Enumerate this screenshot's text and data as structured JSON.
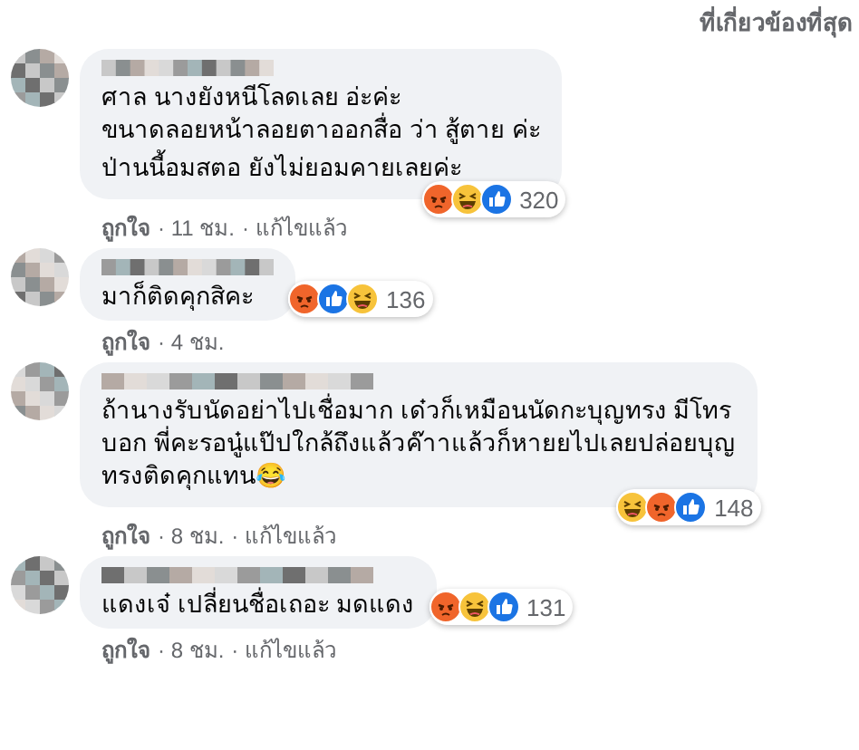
{
  "sort_label": "ที่เกี่ยวข้องที่สุด",
  "comments": [
    {
      "lines": [
        "ศาล นางยังหนีโลดเลย อ่ะค่ะ",
        "ขนาดลอยหน้าลอยตาออกสื่อ ว่า สู้ตาย ค่ะ",
        "ป่านนี้อมสตอ ยังไม่ยอมคายเลยค่ะ"
      ],
      "reactions": [
        {
          "kind": "angry"
        },
        {
          "kind": "haha"
        },
        {
          "kind": "like"
        }
      ],
      "reaction_count": "320",
      "meta": [
        "ถูกใจ",
        "· 11 ชม.",
        "· แก้ไขแล้ว"
      ]
    },
    {
      "lines": [
        "มาก็ติดคุกสิคะ"
      ],
      "reactions": [
        {
          "kind": "angry"
        },
        {
          "kind": "like"
        },
        {
          "kind": "haha"
        }
      ],
      "reaction_count": "136",
      "meta": [
        "ถูกใจ",
        "· 4 ชม."
      ]
    },
    {
      "lines": [
        "ถ้านางรับนัดอย่าไปเชื่อมาก เด๋วก็เหมือนนัดกะบุญทรง มีโทร",
        "บอก พี่คะรอนู๋แป๊ปใกล้ถึงแล้วค๊าาแล้วก็หายยไปเลยปล่อยบุญ",
        "ทรงติดคุกแทน😂"
      ],
      "reactions": [
        {
          "kind": "haha"
        },
        {
          "kind": "angry"
        },
        {
          "kind": "like"
        }
      ],
      "reaction_count": "148",
      "meta": [
        "ถูกใจ",
        "· 8 ชม.",
        "· แก้ไขแล้ว"
      ]
    },
    {
      "lines": [
        "แดงเจ๋ เปลี่ยนชื่อเถอะ มดแดง"
      ],
      "reactions": [
        {
          "kind": "angry"
        },
        {
          "kind": "haha"
        },
        {
          "kind": "like"
        }
      ],
      "reaction_count": "131",
      "meta": [
        "ถูกใจ",
        "· 8 ชม.",
        "· แก้ไขแล้ว"
      ]
    }
  ]
}
